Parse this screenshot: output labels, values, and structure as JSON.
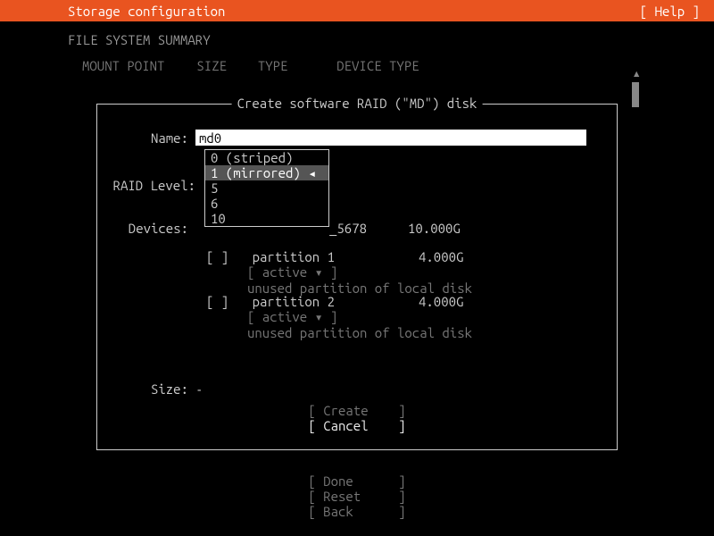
{
  "header": {
    "title": "Storage configuration",
    "help": "[ Help ]"
  },
  "section_title": "FILE SYSTEM SUMMARY",
  "table": {
    "mount": "MOUNT POINT",
    "size": "SIZE",
    "type": "TYPE",
    "devtype": "DEVICE TYPE"
  },
  "dialog": {
    "title": " Create software RAID (\"MD\") disk ",
    "name_label": "Name:",
    "name_value": "md0",
    "raid_label": "RAID Level:",
    "raid_options": {
      "o0": "0 (striped)",
      "o1": "1 (mirrored) ◂",
      "o2": "5",
      "o3": "6",
      "o4": "10"
    },
    "devices_label": "Devices:",
    "dev0_suffix": "_5678",
    "dev0_size": "10.000G",
    "part1": {
      "checkbox": "[ ]",
      "name": "partition 1",
      "size": "4.000G",
      "status": "[ active ▾ ]",
      "desc": "unused partition of local disk"
    },
    "part2": {
      "checkbox": "[ ]",
      "name": "partition 2",
      "size": "4.000G",
      "status": "[ active ▾ ]",
      "desc": "unused partition of local disk"
    },
    "size_label": "Size:",
    "size_value": "-",
    "create_btn": "[ Create    ]",
    "cancel_btn": "[ Cancel    ]"
  },
  "footer": {
    "done": "[ Done      ]",
    "reset": "[ Reset     ]",
    "back": "[ Back      ]"
  }
}
